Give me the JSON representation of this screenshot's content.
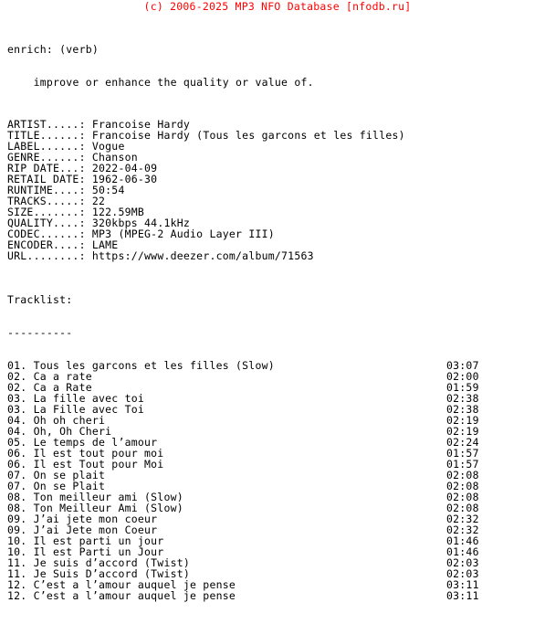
{
  "header": {
    "copyright": "(c) 2006-2025 MP3 NFO Database [nfodb.ru]",
    "color": "#ff0000"
  },
  "definition": {
    "term": "enrich: (verb)",
    "meaning": "improve or enhance the quality or value of."
  },
  "meta": {
    "label_width": 12,
    "fields": [
      {
        "label": "ARTIST",
        "dots": "ARTIST.....:",
        "value": "Francoise Hardy"
      },
      {
        "label": "TITLE",
        "dots": "TITLE......:",
        "value": "Francoise Hardy (Tous les garcons et les filles)"
      },
      {
        "label": "LABEL",
        "dots": "LABEL......:",
        "value": "Vogue"
      },
      {
        "label": "GENRE",
        "dots": "GENRE......:",
        "value": "Chanson"
      },
      {
        "label": "RIP DATE",
        "dots": "RIP DATE...:",
        "value": "2022-04-09"
      },
      {
        "label": "RETAIL DATE",
        "dots": "RETAIL DATE:",
        "value": "1962-06-30"
      },
      {
        "label": "RUNTIME",
        "dots": "RUNTIME....:",
        "value": "50:54"
      },
      {
        "label": "TRACKS",
        "dots": "TRACKS.....:",
        "value": "22"
      },
      {
        "label": "SIZE",
        "dots": "SIZE.......:",
        "value": "122.59MB"
      },
      {
        "label": "QUALITY",
        "dots": "QUALITY....:",
        "value": "320kbps 44.1kHz"
      },
      {
        "label": "CODEC",
        "dots": "CODEC......:",
        "value": "MP3 (MPEG-2 Audio Layer III)"
      },
      {
        "label": "ENCODER",
        "dots": "ENCODER....:",
        "value": "LAME"
      },
      {
        "label": "URL",
        "dots": "URL........:",
        "value": "https://www.deezer.com/album/71563"
      }
    ]
  },
  "tracklist": {
    "heading": "Tracklist:",
    "rule": "----------",
    "tracks": [
      {
        "num": "01.",
        "title": "Tous les garcons et les filles (Slow)",
        "time": "03:07"
      },
      {
        "num": "02.",
        "title": "Ca a rate",
        "time": "02:00"
      },
      {
        "num": "02.",
        "title": "Ca a Rate",
        "time": "01:59"
      },
      {
        "num": "03.",
        "title": "La fille avec toi",
        "time": "02:38"
      },
      {
        "num": "03.",
        "title": "La Fille avec Toi",
        "time": "02:38"
      },
      {
        "num": "04.",
        "title": "Oh oh cheri",
        "time": "02:19"
      },
      {
        "num": "04.",
        "title": "Oh, Oh Cheri",
        "time": "02:19"
      },
      {
        "num": "05.",
        "title": "Le temps de l’amour",
        "time": "02:24"
      },
      {
        "num": "06.",
        "title": "Il est tout pour moi",
        "time": "01:57"
      },
      {
        "num": "06.",
        "title": "Il est Tout pour Moi",
        "time": "01:57"
      },
      {
        "num": "07.",
        "title": "On se plait",
        "time": "02:08"
      },
      {
        "num": "07.",
        "title": "On se Plait",
        "time": "02:08"
      },
      {
        "num": "08.",
        "title": "Ton meilleur ami (Slow)",
        "time": "02:08"
      },
      {
        "num": "08.",
        "title": "Ton Meilleur Ami (Slow)",
        "time": "02:08"
      },
      {
        "num": "09.",
        "title": "J’ai jete mon coeur",
        "time": "02:32"
      },
      {
        "num": "09.",
        "title": "J’ai Jete mon Coeur",
        "time": "02:32"
      },
      {
        "num": "10.",
        "title": "Il est parti un jour",
        "time": "01:46"
      },
      {
        "num": "10.",
        "title": "Il est Parti un Jour",
        "time": "01:46"
      },
      {
        "num": "11.",
        "title": "Je suis d’accord (Twist)",
        "time": "02:03"
      },
      {
        "num": "11.",
        "title": "Je Suis D’accord (Twist)",
        "time": "02:03"
      },
      {
        "num": "12.",
        "title": "C’est a l’amour auquel je pense",
        "time": "03:11"
      },
      {
        "num": "12.",
        "title": "C’est a l’amour auquel je pense",
        "time": "03:11"
      }
    ]
  }
}
